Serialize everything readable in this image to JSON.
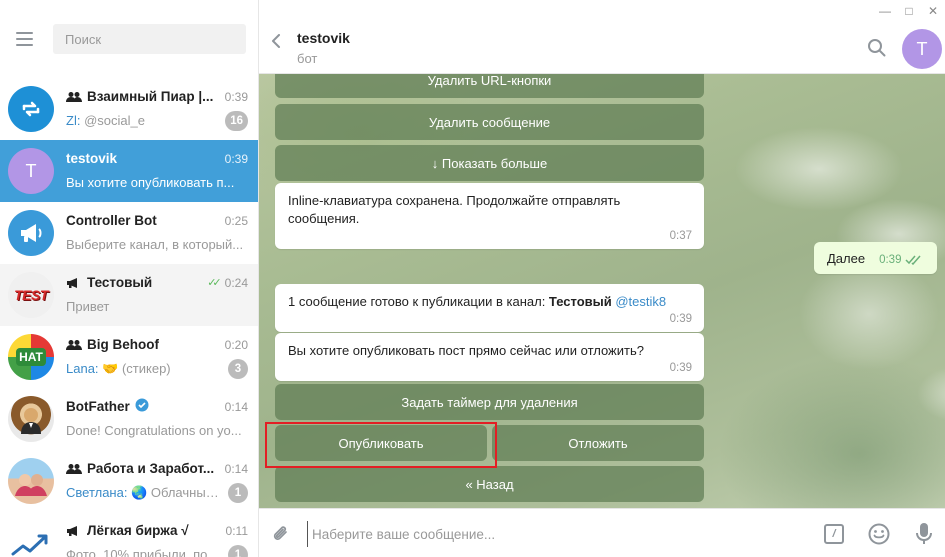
{
  "window": {
    "minimize": "—",
    "maximize": "□",
    "close": "✕"
  },
  "sidebar": {
    "search_placeholder": "Поиск",
    "chats": [
      {
        "name": "Взаимный Пиар |...",
        "time": "0:39",
        "from": "Zl:",
        "preview": "@social_e",
        "badge": "16",
        "avatar_color": "#1e90d6",
        "avatar_icon": "repost-icon",
        "type": "group"
      },
      {
        "name": "testovik",
        "time": "0:39",
        "from": "",
        "preview": "Вы хотите опубликовать п...",
        "badge": "",
        "avatar_color": "#b296e6",
        "avatar_letter": "T",
        "type": "bot",
        "active": true
      },
      {
        "name": "Controller Bot",
        "time": "0:25",
        "from": "",
        "preview": "Выберите канал, в который...",
        "badge": "",
        "avatar_color": "#3a9ad9",
        "avatar_icon": "megaphone-icon",
        "type": "bot"
      },
      {
        "name": "Тестовый",
        "time": "0:24",
        "from": "",
        "preview": "Привет",
        "badge": "",
        "avatar_text": "TEST",
        "avatar_color": "#f4f4f4",
        "type": "channel",
        "read": true
      },
      {
        "name": "Big Behoof",
        "time": "0:20",
        "from": "Lana:",
        "preview": "🤝 (стикер)",
        "badge": "3",
        "avatar_text": "HAT",
        "avatar_color": "#2e8b3a",
        "type": "group"
      },
      {
        "name": "BotFather",
        "time": "0:14",
        "from": "",
        "preview": "Done! Congratulations on yo...",
        "badge": "",
        "avatar_color": "#c8a06a",
        "avatar_icon": "botfather-icon",
        "type": "bot",
        "verified": true
      },
      {
        "name": "Работа и Заработ...",
        "time": "0:14",
        "from": "Светлана:",
        "preview": "🌏 Облачный...",
        "badge": "1",
        "avatar_color": "#7ab8e0",
        "avatar_icon": "photo-icon",
        "type": "group"
      },
      {
        "name": "Лёгкая биржа √",
        "time": "0:11",
        "from": "",
        "preview": "Фото, 10% прибыли, по...",
        "badge": "1",
        "avatar_color": "#ffffff",
        "avatar_icon": "chart-arrow-icon",
        "type": "channel"
      }
    ]
  },
  "header": {
    "title": "testovik",
    "subtitle": "бот",
    "avatar_letter": "T"
  },
  "messages": {
    "kb_top": [
      "Удалить URL-кнопки",
      "Удалить сообщение",
      "↓ Показать больше"
    ],
    "msg1_text": "Inline-клавиатура сохранена. Продолжайте отправлять сообщения.",
    "msg1_time": "0:37",
    "out_text": "Далее",
    "out_time": "0:39",
    "msg2_prefix": "1 сообщение готово к публикации в канал: ",
    "msg2_channel": "Тестовый",
    "msg2_link": "@testik8",
    "msg2_time": "0:39",
    "msg3_text": "Вы хотите опубликовать пост прямо сейчас или отложить?",
    "msg3_time": "0:39",
    "kb_bottom": {
      "timer": "Задать таймер для удаления",
      "publish": "Опубликовать",
      "postpone": "Отложить",
      "back": "« Назад"
    }
  },
  "composer": {
    "placeholder": "Наберите ваше сообщение..."
  },
  "colors": {
    "accent": "#419fd9",
    "highlight": "#e31e24",
    "keyboard_button": "#5f7d55"
  }
}
